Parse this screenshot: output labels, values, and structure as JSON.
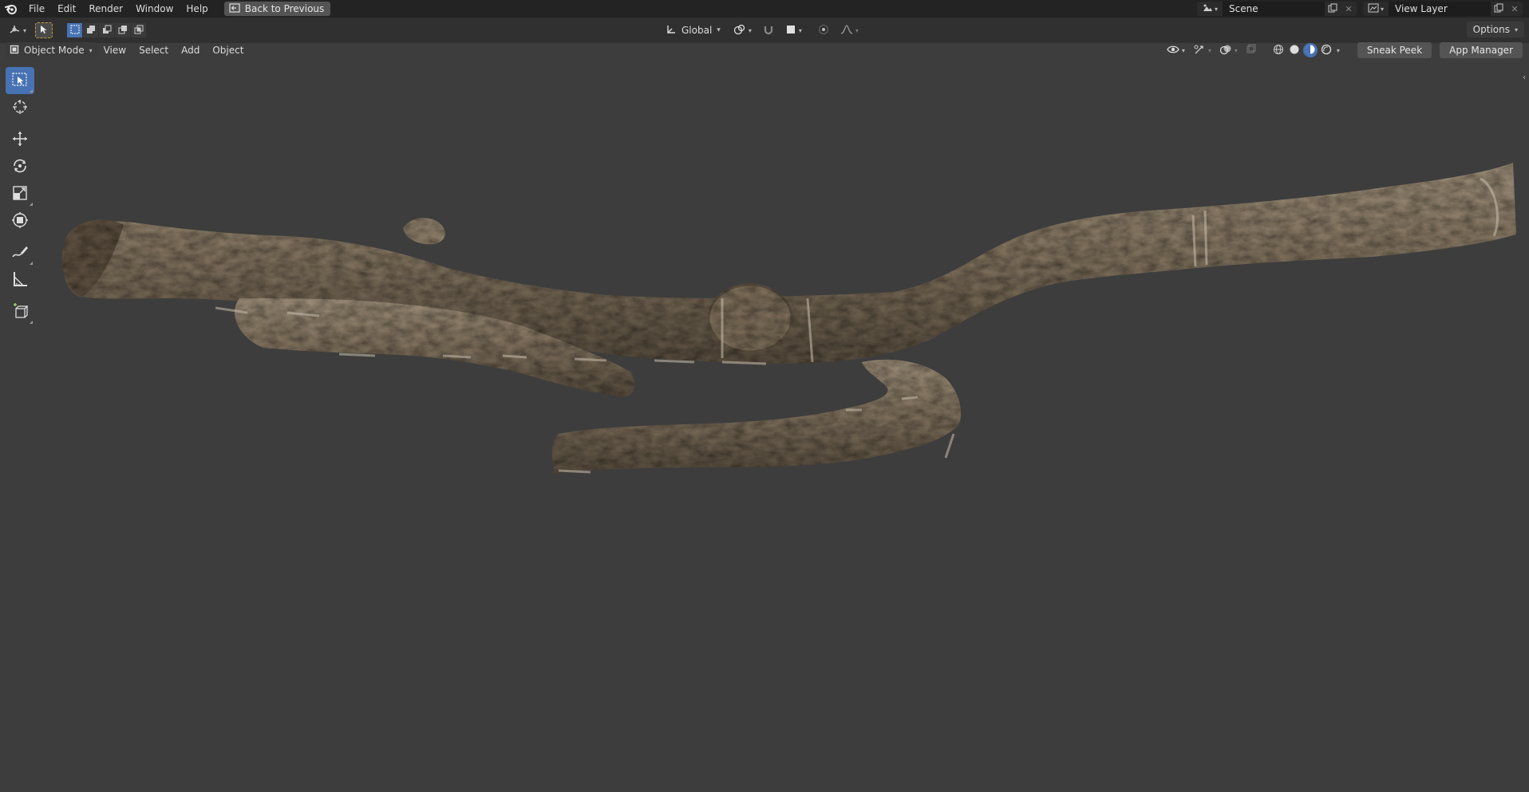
{
  "topbar": {
    "menus": [
      "File",
      "Edit",
      "Render",
      "Window",
      "Help"
    ],
    "back_button": "Back to Previous",
    "scene_name": "Scene",
    "view_layer_name": "View Layer"
  },
  "toolheader": {
    "transform_orientation": "Global",
    "options_label": "Options"
  },
  "viewport_header": {
    "mode": "Object Mode",
    "menus": [
      "View",
      "Select",
      "Add",
      "Object"
    ],
    "sneak_peek": "Sneak Peek",
    "app_manager": "App Manager"
  },
  "toolbar": {
    "tools": [
      "select-box-icon",
      "cursor-icon",
      "move-icon",
      "rotate-icon",
      "scale-icon",
      "transform-icon",
      "annotate-icon",
      "measure-icon",
      "add-cube-icon"
    ],
    "active_tool": "select-box-icon"
  },
  "viewport": {
    "object": "branch-mesh"
  },
  "colors": {
    "accent": "#4772b3",
    "viewport_bg": "#3d3d3d",
    "header_bg": "#303030",
    "topbar_bg": "#232323",
    "bark": "#7b6d5a"
  }
}
